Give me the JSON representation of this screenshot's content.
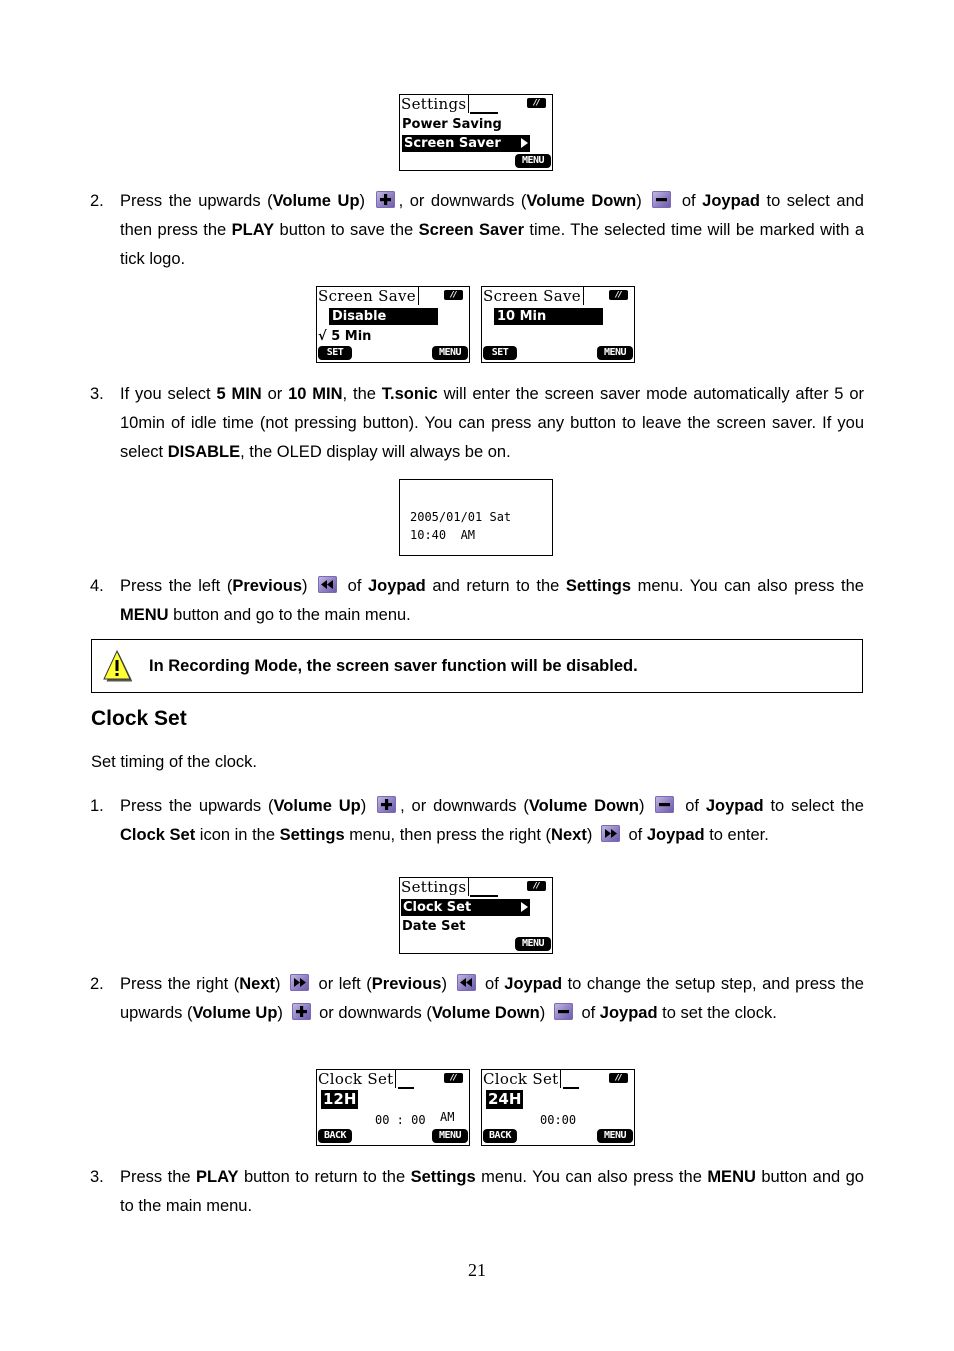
{
  "screens": {
    "settings_screen_saver": {
      "title": "Settings",
      "items": [
        "Power Saving",
        "Screen Saver"
      ],
      "selected_index": 1,
      "softkey_right": "MENU",
      "battery": "//"
    },
    "screen_save_disable": {
      "title": "Screen Save",
      "items": [
        "Disable",
        "5 Min"
      ],
      "selected_index": 0,
      "checked_item": "√ 5 Min",
      "softkey_left": "SET",
      "softkey_right": "MENU",
      "battery": "//"
    },
    "screen_save_10min": {
      "title": "Screen Save",
      "items": [
        "10 Min"
      ],
      "selected_index": 0,
      "softkey_left": "SET",
      "softkey_right": "MENU",
      "battery": "//"
    },
    "clock_display": {
      "date_line": "2005/01/01  Sat",
      "time_line": "10:40  AM"
    },
    "settings_clock_set": {
      "title": "Settings",
      "items": [
        "Clock Set",
        "Date Set"
      ],
      "selected_index": 0,
      "softkey_right": "MENU",
      "battery": "//"
    },
    "clock_set_12h": {
      "title": "Clock Set",
      "mode": "12H",
      "time": "00 : 00",
      "ampm": "AM",
      "softkey_left": "BACK",
      "softkey_right": "MENU",
      "battery": "//"
    },
    "clock_set_24h": {
      "title": "Clock Set",
      "mode": "24H",
      "time": "00:00",
      "softkey_left": "BACK",
      "softkey_right": "MENU",
      "battery": "//"
    }
  },
  "icons": {
    "volume_up": "plus-icon",
    "volume_down": "minus-icon",
    "previous": "rewind-icon",
    "next": "fast-forward-icon",
    "warning": "warning-icon"
  },
  "colors": {
    "icon_purple": "#8f7fc4",
    "warning_yellow": "#ffff33"
  },
  "steps_screen_saver": [
    {
      "num": "2.",
      "parts": [
        "Press the upwards (",
        "Volume Up",
        ") ",
        ", or downwards (",
        "Volume Down",
        ") ",
        " of ",
        "Joypad",
        " to select and then press the ",
        "PLAY",
        " button to save the ",
        "Screen Saver",
        " time. The selected time will be marked with a tick logo."
      ]
    },
    {
      "num": "3.",
      "parts": [
        "If you select ",
        "5 MIN",
        " or ",
        "10 MIN",
        ", the ",
        "T.sonic",
        " will enter the screen saver mode automatically after 5 or 10min of idle time (not pressing button). You can press any button to leave the screen saver. If you select ",
        "DISABLE",
        ", the OLED display will always be on."
      ]
    },
    {
      "num": "4.",
      "parts": [
        "Press the left (",
        "Previous",
        ") ",
        " of ",
        "Joypad",
        " and return to the ",
        "Settings",
        " menu. You can also press the ",
        "MENU",
        " button and go to the main menu."
      ]
    }
  ],
  "note": {
    "text": "In Recording Mode, the screen saver function will be disabled."
  },
  "clock_set": {
    "heading": "Clock Set",
    "intro": "Set timing of the clock.",
    "steps": [
      {
        "num": "1.",
        "parts": [
          "Press the upwards (",
          "Volume Up",
          ") ",
          ", or downwards (",
          "Volume Down",
          ") ",
          " of ",
          "Joypad",
          " to select the ",
          "Clock Set",
          " icon in the ",
          "Settings",
          " menu, then press the right (",
          "Next",
          ") ",
          " of ",
          "Joypad",
          " to enter."
        ]
      },
      {
        "num": "2.",
        "parts": [
          "Press the right (",
          "Next",
          ") ",
          " or left (",
          "Previous",
          ") ",
          " of ",
          "Joypad",
          " to change the setup step, and press the upwards (",
          "Volume Up",
          ") ",
          " or downwards (",
          "Volume Down",
          ") ",
          " of ",
          "Joypad",
          " to set the clock."
        ]
      },
      {
        "num": "3.",
        "parts": [
          "Press the ",
          "PLAY",
          " button to return to the ",
          "Settings",
          " menu. You can also press the ",
          "MENU",
          " button and go to the main menu."
        ]
      }
    ]
  },
  "page_number": "21"
}
